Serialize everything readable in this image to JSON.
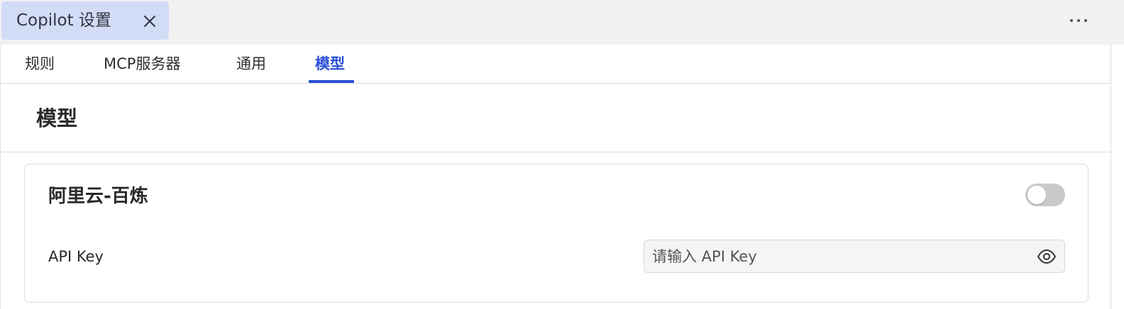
{
  "editor_tab": {
    "title": "Copilot 设置",
    "close_icon": "close-icon"
  },
  "toolbar": {
    "more_icon": "more-horizontal-icon"
  },
  "settings_tabs": [
    {
      "label": "规则",
      "active": false
    },
    {
      "label": "MCP服务器",
      "active": false
    },
    {
      "label": "通用",
      "active": false
    },
    {
      "label": "模型",
      "active": true
    }
  ],
  "section": {
    "title": "模型"
  },
  "provider_card": {
    "title": "阿里云-百炼",
    "enabled": false,
    "api_key": {
      "label": "API Key",
      "value": "",
      "placeholder": "请输入 API Key",
      "visibility_icon": "eye-icon"
    }
  },
  "colors": {
    "accent": "#2a4ed6",
    "editor_tab_bg": "#d3dcf6",
    "toggle_off": "#c9c9c9"
  }
}
